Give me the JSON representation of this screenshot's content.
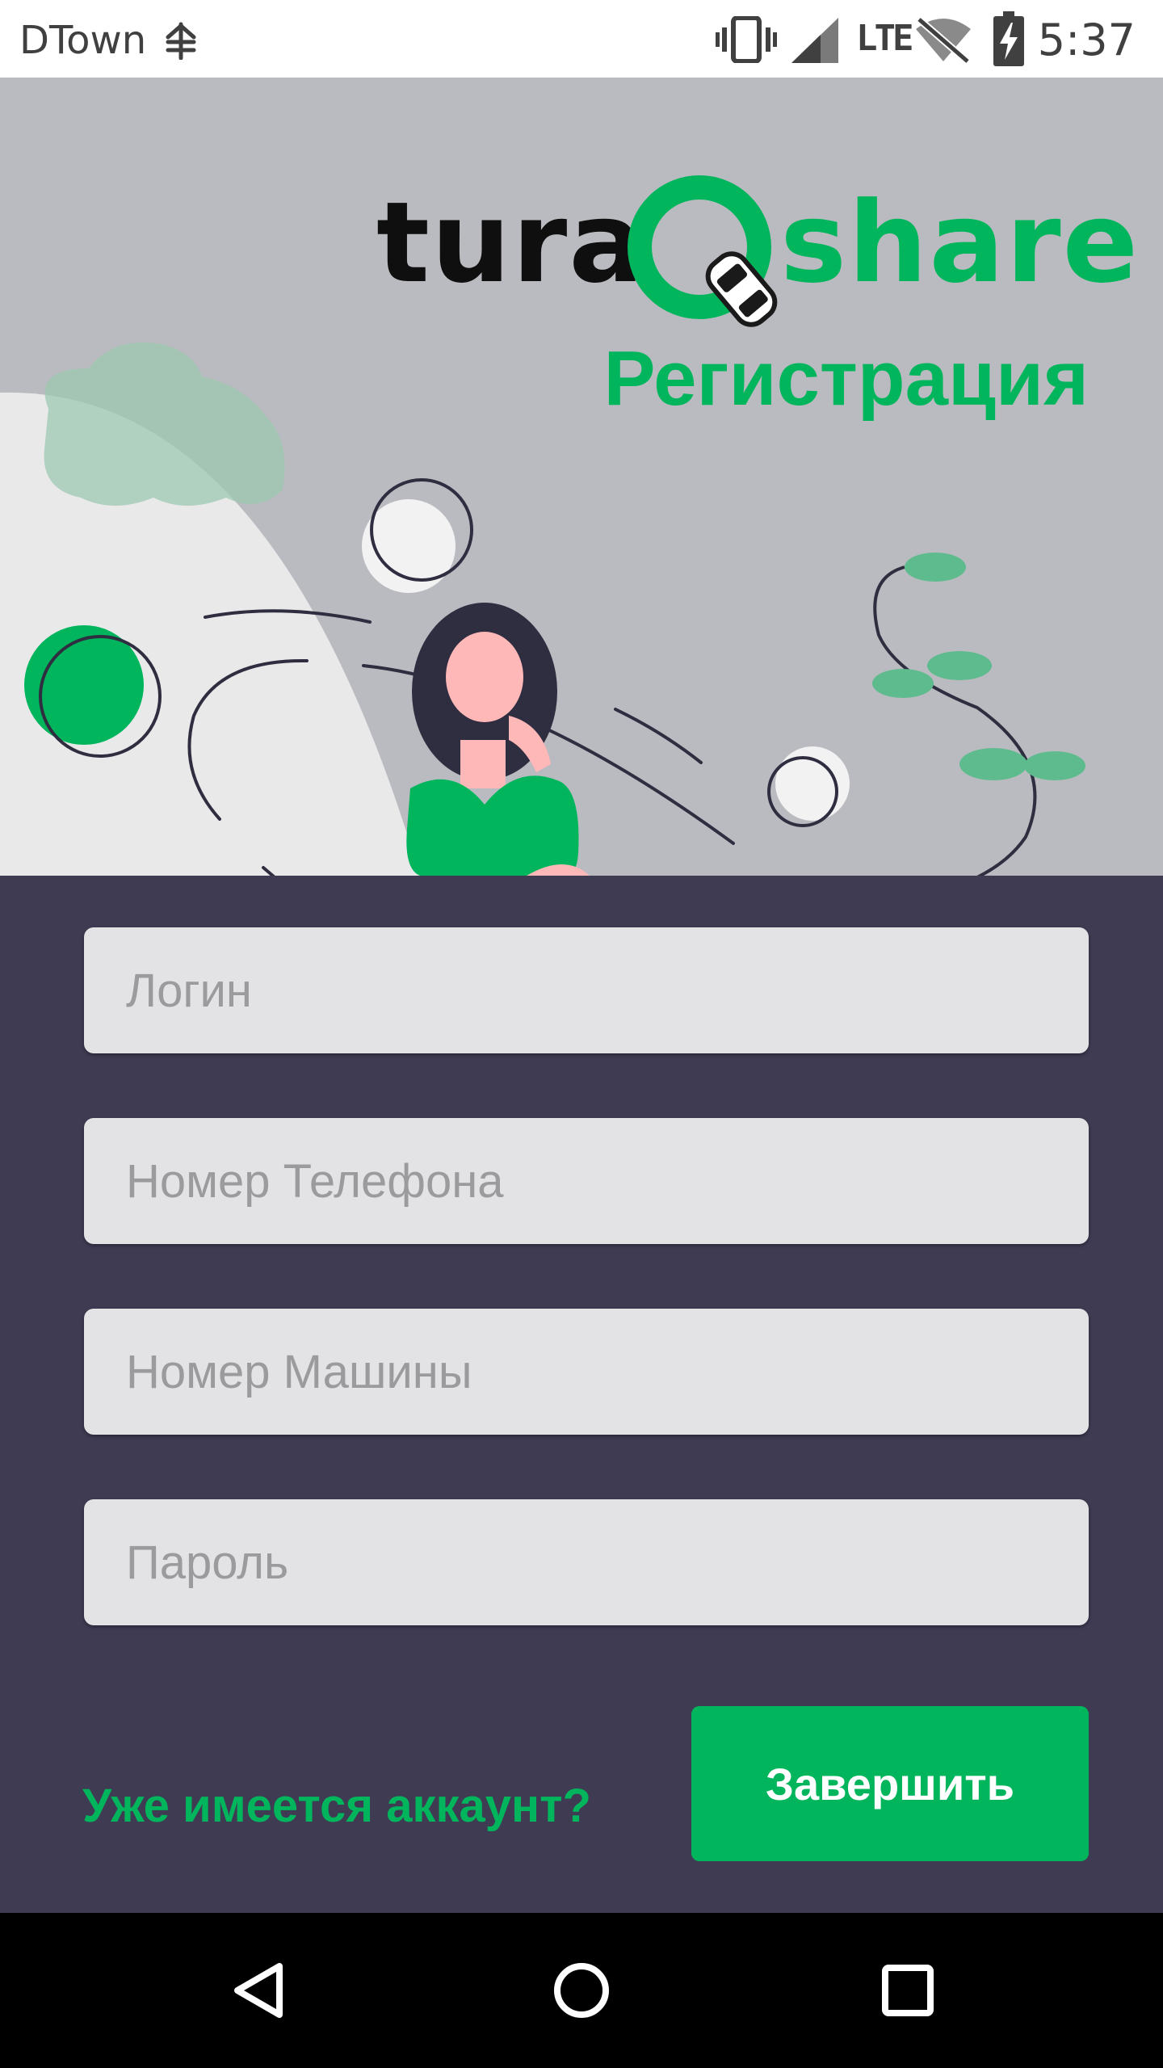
{
  "status_bar": {
    "carrier": "DTown",
    "time": "5:37",
    "network_label": "LTE",
    "icons": [
      "network-tree-icon",
      "vibrate-icon",
      "signal-icon",
      "lte-icon",
      "wifi-off-icon",
      "battery-charging-icon"
    ]
  },
  "header": {
    "logo_left": "tura",
    "logo_right": "share",
    "title": "Регистрация"
  },
  "form": {
    "login_placeholder": "Логин",
    "phone_placeholder": "Номер Телефона",
    "car_placeholder": "Номер Машины",
    "password_placeholder": "Пароль",
    "login_value": "",
    "phone_value": "",
    "car_value": "",
    "password_value": "",
    "have_account_link": "Уже имеется аккаунт?",
    "submit_label": "Завершить"
  },
  "nav_bar": {
    "icons": [
      "back-icon",
      "home-icon",
      "recents-icon"
    ]
  },
  "colors": {
    "accent": "#00b55c",
    "hero_bg": "#babbc0",
    "panel_bg": "#3e3b53",
    "field_bg": "#e3e3e6"
  }
}
